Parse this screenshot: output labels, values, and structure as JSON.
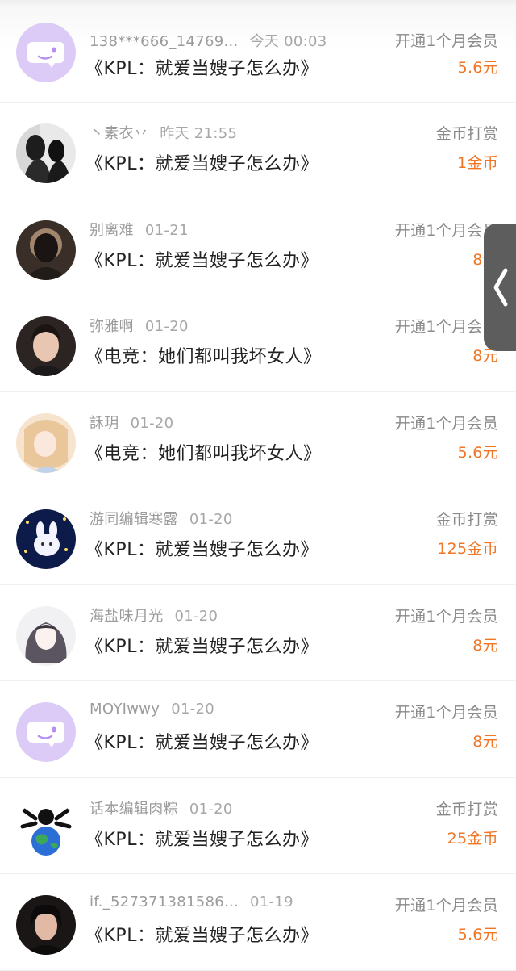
{
  "rows": [
    {
      "user": "138***666_14769...",
      "time": "今天 00:03",
      "book": "《KPL：就爱当嫂子怎么办》",
      "type": "开通1个月会员",
      "amount": "5.6元",
      "avatar": "default-purple-icon"
    },
    {
      "user": "丶素衣丷",
      "time": "昨天 21:55",
      "book": "《KPL：就爱当嫂子怎么办》",
      "type": "金币打赏",
      "amount": "1金币",
      "avatar": "photo-avatar"
    },
    {
      "user": "别离难",
      "time": "01-21",
      "book": "《KPL：就爱当嫂子怎么办》",
      "type": "开通1个月会员",
      "amount": "8元",
      "avatar": "photo-avatar"
    },
    {
      "user": "弥雅啊",
      "time": "01-20",
      "book": "《电竞：她们都叫我坏女人》",
      "type": "开通1个月会员",
      "amount": "8元",
      "avatar": "photo-avatar"
    },
    {
      "user": "訸玥",
      "time": "01-20",
      "book": "《电竞：她们都叫我坏女人》",
      "type": "开通1个月会员",
      "amount": "5.6元",
      "avatar": "illustration-avatar"
    },
    {
      "user": "游同编辑寒露",
      "time": "01-20",
      "book": "《KPL：就爱当嫂子怎么办》",
      "type": "金币打赏",
      "amount": "125金币",
      "avatar": "illustration-avatar"
    },
    {
      "user": "海盐味月光",
      "time": "01-20",
      "book": "《KPL：就爱当嫂子怎么办》",
      "type": "开通1个月会员",
      "amount": "8元",
      "avatar": "illustration-avatar"
    },
    {
      "user": "MOYIwwy",
      "time": "01-20",
      "book": "《KPL：就爱当嫂子怎么办》",
      "type": "开通1个月会员",
      "amount": "8元",
      "avatar": "default-purple-icon"
    },
    {
      "user": "话本编辑肉粽",
      "time": "01-20",
      "book": "《KPL：就爱当嫂子怎么办》",
      "type": "金币打赏",
      "amount": "25金币",
      "avatar": "earth-avatar"
    },
    {
      "user": "if._527371381586...",
      "time": "01-19",
      "book": "《KPL：就爱当嫂子怎么办》",
      "type": "开通1个月会员",
      "amount": "5.6元",
      "avatar": "photo-avatar"
    }
  ],
  "side_tab": {
    "icon": "chevron-left-icon"
  },
  "colors": {
    "amount": "#f07524",
    "meta": "#9b9b9b",
    "title": "#222222",
    "default_avatar": "#d9c5f5",
    "side_tab": "#5d5d5d"
  }
}
